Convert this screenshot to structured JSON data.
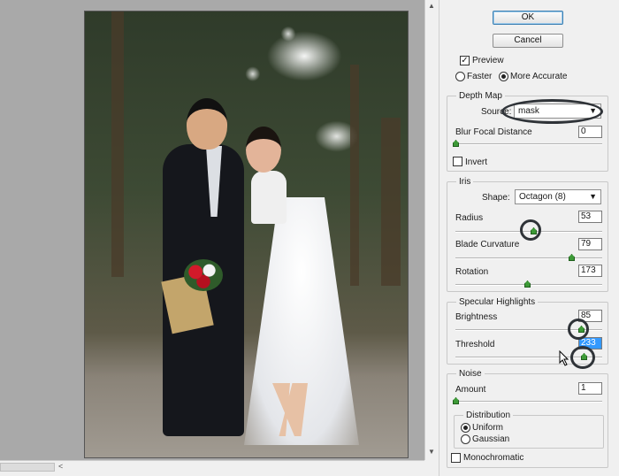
{
  "buttons": {
    "ok": "OK",
    "cancel": "Cancel"
  },
  "preview": {
    "checkbox_label": "Preview",
    "checked": true,
    "mode_options": [
      "Faster",
      "More Accurate"
    ],
    "selected_mode": "More Accurate"
  },
  "depth_map": {
    "title": "Depth Map",
    "source_label": "Source:",
    "source_value": "mask",
    "blur_focal_label": "Blur Focal Distance",
    "blur_focal_value": "0",
    "invert_label": "Invert",
    "invert_checked": false
  },
  "iris": {
    "title": "Iris",
    "shape_label": "Shape:",
    "shape_value": "Octagon (8)",
    "radius_label": "Radius",
    "radius_value": "53",
    "blade_label": "Blade Curvature",
    "blade_value": "79",
    "rotation_label": "Rotation",
    "rotation_value": "173"
  },
  "specular": {
    "title": "Specular Highlights",
    "brightness_label": "Brightness",
    "brightness_value": "85",
    "threshold_label": "Threshold",
    "threshold_value": "233"
  },
  "noise": {
    "title": "Noise",
    "amount_label": "Amount",
    "amount_value": "1",
    "distribution_title": "Distribution",
    "distribution_options": [
      "Uniform",
      "Gaussian"
    ],
    "selected_distribution": "Uniform",
    "monochromatic_label": "Monochromatic",
    "monochromatic_checked": false
  },
  "icons": {
    "chevron": "chevron-down-icon",
    "checkmark": "checkmark-icon",
    "scroll_up": "scroll-up-arrow-icon",
    "scroll_down": "scroll-down-arrow-icon",
    "scroll_left": "scroll-left-arrow-icon",
    "cursor": "mouse-cursor-icon"
  },
  "colors": {
    "accent_slider_thumb": "#3d9a37",
    "selection_highlight": "#3399ff",
    "annotation_ring": "#2f3338",
    "canvas_background": "#a9a9a9",
    "panel_background": "#f0f0f0"
  }
}
